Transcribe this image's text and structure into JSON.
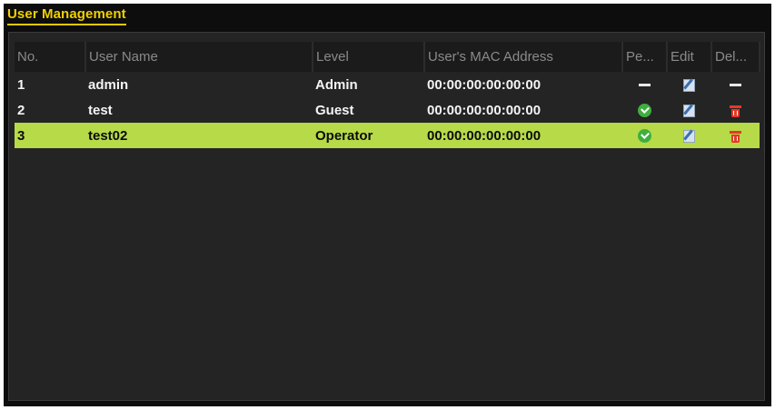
{
  "window": {
    "title": "User Management"
  },
  "table": {
    "headers": {
      "no": "No.",
      "user_name": "User Name",
      "level": "Level",
      "mac": "User's MAC Address",
      "permission": "Pe...",
      "edit": "Edit",
      "delete": "Del..."
    },
    "rows": [
      {
        "no": "1",
        "user_name": "admin",
        "level": "Admin",
        "mac": "00:00:00:00:00:00",
        "permission_icon": "dash-icon",
        "edit_icon": "edit-icon",
        "delete_icon": "dash-icon"
      },
      {
        "no": "2",
        "user_name": "test",
        "level": "Guest",
        "mac": "00:00:00:00:00:00",
        "permission_icon": "check-icon",
        "edit_icon": "edit-icon",
        "delete_icon": "trash-icon"
      },
      {
        "no": "3",
        "user_name": "test02",
        "level": "Operator",
        "mac": "00:00:00:00:00:00",
        "permission_icon": "check-icon",
        "edit_icon": "edit-icon",
        "delete_icon": "trash-icon",
        "selected": true
      }
    ]
  },
  "colors": {
    "title": "#f0d000",
    "selected_row": "#b6da48",
    "background": "#242424",
    "check": "#3fae3f",
    "delete": "#e23a2a"
  }
}
